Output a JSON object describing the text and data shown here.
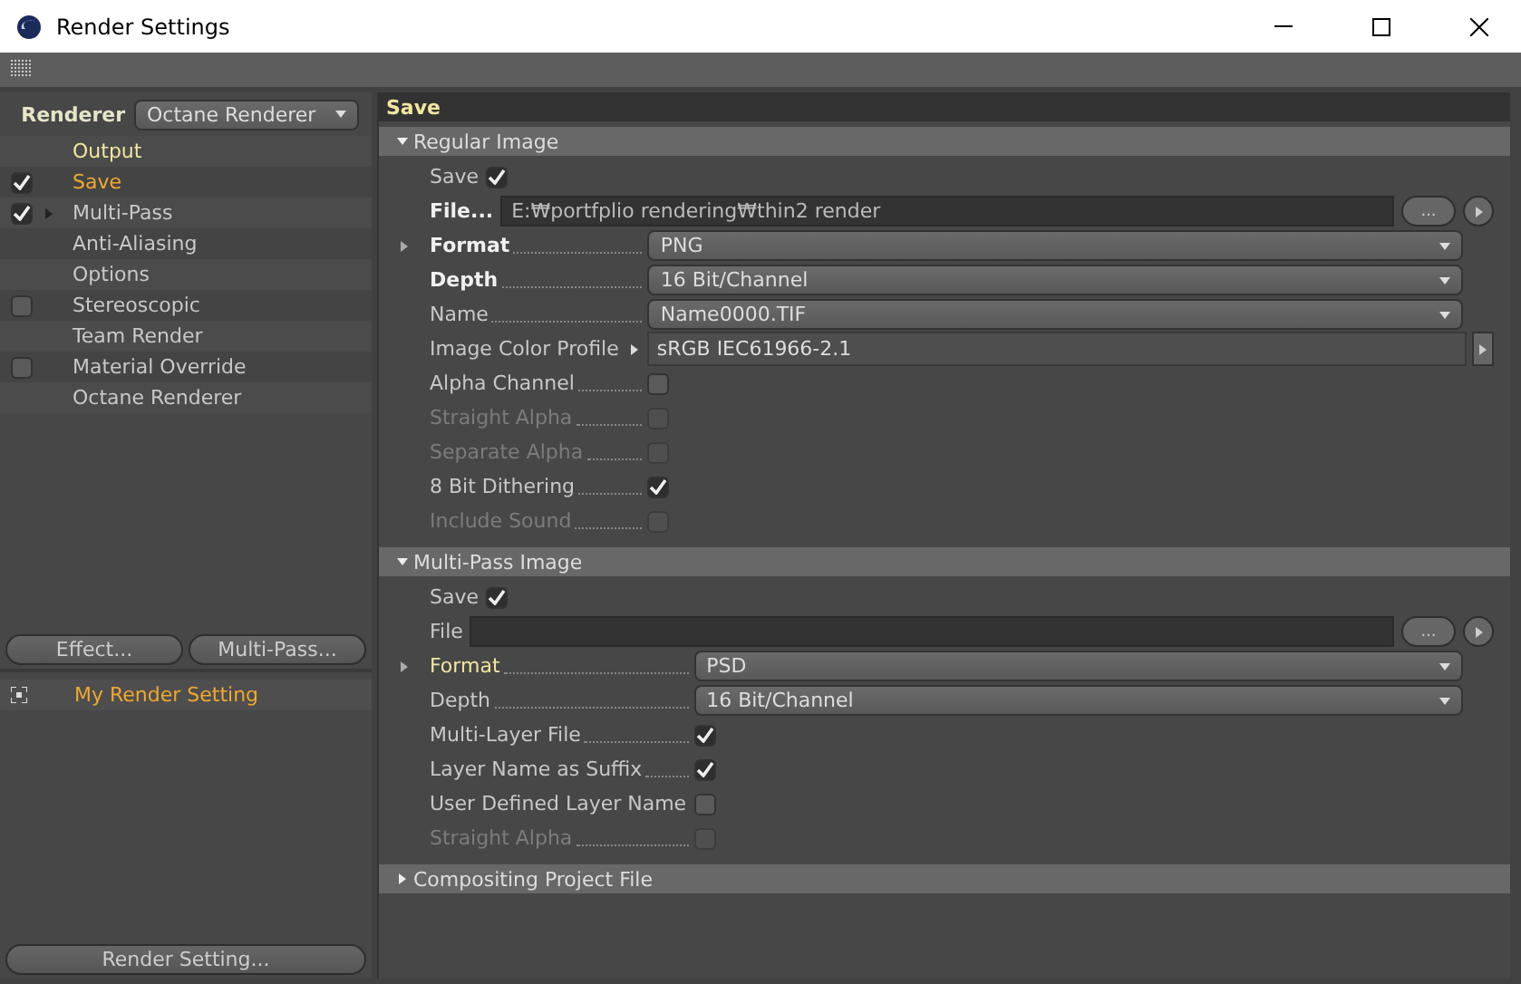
{
  "window": {
    "title": "Render Settings"
  },
  "renderer": {
    "label": "Renderer",
    "value": "Octane Renderer"
  },
  "settings_tree": [
    {
      "label": "Output",
      "kind": "plain",
      "selected": false,
      "highlighted": true,
      "has_children": false
    },
    {
      "label": "Save",
      "kind": "check",
      "checked": true,
      "selected": true,
      "highlighted": false,
      "has_children": false
    },
    {
      "label": "Multi-Pass",
      "kind": "check",
      "checked": true,
      "selected": false,
      "highlighted": false,
      "has_children": true
    },
    {
      "label": "Anti-Aliasing",
      "kind": "plain",
      "selected": false,
      "highlighted": false,
      "has_children": false
    },
    {
      "label": "Options",
      "kind": "plain",
      "selected": false,
      "highlighted": false,
      "has_children": false
    },
    {
      "label": "Stereoscopic",
      "kind": "check",
      "checked": false,
      "selected": false,
      "highlighted": false,
      "has_children": false
    },
    {
      "label": "Team Render",
      "kind": "plain",
      "selected": false,
      "highlighted": false,
      "has_children": false
    },
    {
      "label": "Material Override",
      "kind": "check",
      "checked": false,
      "selected": false,
      "highlighted": false,
      "has_children": false
    },
    {
      "label": "Octane Renderer",
      "kind": "plain",
      "selected": false,
      "highlighted": false,
      "has_children": false
    }
  ],
  "left_buttons": [
    "Effect...",
    "Multi-Pass..."
  ],
  "render_settings": [
    {
      "label": "My Render Setting",
      "selected": true
    }
  ],
  "bottom_button": "Render Setting...",
  "panel_title": "Save",
  "sections": [
    {
      "title": "Regular Image",
      "expanded": true,
      "fields": [
        {
          "kind": "toggle",
          "label": "Save",
          "checked": true
        },
        {
          "kind": "file",
          "label": "File...",
          "value": "E:₩portfplio rendering₩thin2 render",
          "bold": true,
          "button": "..."
        },
        {
          "kind": "dropdown",
          "label": "Format",
          "value": "PNG",
          "bold": true,
          "expandable": true,
          "highlighted": false
        },
        {
          "kind": "dropdown",
          "label": "Depth",
          "value": "16 Bit/Channel",
          "bold": true,
          "expandable": false,
          "highlighted": false
        },
        {
          "kind": "dropdown",
          "label": "Name",
          "value": "Name0000.TIF",
          "bold": false,
          "expandable": false,
          "highlighted": false
        },
        {
          "kind": "profile",
          "label": "Image Color Profile",
          "value": "sRGB IEC61966-2.1"
        },
        {
          "kind": "check",
          "label": "Alpha Channel",
          "checked": false,
          "disabled": false,
          "leader": true
        },
        {
          "kind": "check",
          "label": "Straight Alpha",
          "checked": false,
          "disabled": true,
          "leader": true
        },
        {
          "kind": "check",
          "label": "Separate Alpha",
          "checked": false,
          "disabled": true,
          "leader": true
        },
        {
          "kind": "check",
          "label": "8 Bit Dithering",
          "checked": true,
          "disabled": false,
          "leader": true
        },
        {
          "kind": "check",
          "label": "Include Sound",
          "checked": false,
          "disabled": true,
          "leader": true
        }
      ]
    },
    {
      "title": "Multi-Pass Image",
      "expanded": true,
      "fields": [
        {
          "kind": "toggle",
          "label": "Save",
          "checked": true
        },
        {
          "kind": "file",
          "label": "File",
          "bold": false,
          "button": "..."
        },
        {
          "kind": "dropdown",
          "label": "Format",
          "value": "PSD",
          "bold": false,
          "expandable": true,
          "highlighted": true
        },
        {
          "kind": "dropdown",
          "label": "Depth",
          "value": "16 Bit/Channel",
          "bold": false,
          "expandable": false,
          "highlighted": false
        },
        {
          "kind": "check",
          "label": "Multi-Layer File",
          "checked": true,
          "disabled": false,
          "leader": true
        },
        {
          "kind": "check",
          "label": "Layer Name as Suffix",
          "checked": true,
          "disabled": false,
          "leader": true
        },
        {
          "kind": "check",
          "label": "User Defined Layer Name",
          "checked": false,
          "disabled": false,
          "leader": false
        },
        {
          "kind": "check",
          "label": "Straight Alpha",
          "checked": false,
          "disabled": true,
          "leader": true
        }
      ]
    },
    {
      "title": "Compositing Project File",
      "expanded": false
    }
  ]
}
